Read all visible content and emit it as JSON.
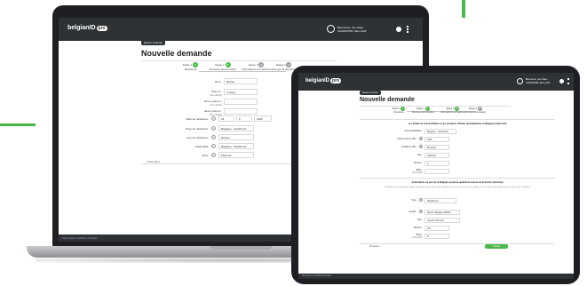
{
  "colors": {
    "accent": "#4ab84a",
    "header": "#2e3235",
    "device": "#1e1f22"
  },
  "laptop": {
    "app_logo": "belgianID",
    "logo_badge": "pro",
    "user_line1": "Bienvenue, Jan Claes",
    "user_line2": "0123456789 | Mon profil",
    "back_label": "Retour à l'écran",
    "page_title": "Nouvelle demande",
    "steps": [
      {
        "label": "Étape 1",
        "num": "1",
        "name": "Résidents",
        "status": "done"
      },
      {
        "label": "Étape 2",
        "num": "2",
        "name": "Données personnelles",
        "status": "done"
      },
      {
        "label": "Étape 3",
        "num": "3",
        "name": "Informations de l'adresse",
        "status": "todo"
      },
      {
        "label": "Étape 4",
        "num": "4",
        "name": "Envoyer la demande",
        "status": "todo"
      }
    ],
    "fields": [
      {
        "label": "Nom :",
        "value": "Buisse"
      },
      {
        "label": "Prénom :",
        "sub": "(Facultatif)",
        "value": "Ludwig"
      },
      {
        "label": "2ème prénom :",
        "sub": "(Facultatif)",
        "value": ""
      },
      {
        "label": "3ème prénom :",
        "sub": "(Facultatif)",
        "value": ""
      }
    ],
    "birth": {
      "label": "Date de naissance :",
      "day": "04",
      "month": "6",
      "year": "1992"
    },
    "fields2": [
      {
        "label": "Pays de naissance :",
        "value": "Belgique - Nederland"
      },
      {
        "label": "Lieu de naissance :",
        "value": "Namen"
      },
      {
        "label": "Nationalité :",
        "value": "Belgique - Nederland"
      },
      {
        "label": "Sexe :",
        "value": "Masculin"
      }
    ],
    "prev_label": "Précédent",
    "footer_links": "Vie privée   Conditions   Contact"
  },
  "tablet": {
    "app_logo": "belgianID",
    "logo_badge": "pro",
    "user_line1": "Bienvenue, Jan Claes",
    "user_line2": "0123456789 | Mon profil",
    "back_label": "Retour à l'écran",
    "page_title": "Nouvelle demande",
    "steps": [
      {
        "label": "Étape 1",
        "num": "1",
        "name": "Résidents",
        "status": "done"
      },
      {
        "label": "Étape 2",
        "num": "2",
        "name": "Données personnelles",
        "status": "done"
      },
      {
        "label": "Étape 3",
        "num": "3",
        "name": "Informations de l'adresse",
        "status": "done"
      },
      {
        "label": "Étape 4",
        "num": "4",
        "name": "Envoyer la demande",
        "status": "todo"
      }
    ],
    "section1_title": "Les détails de la domiciliation et les résidents officiels (actuellement) en Belgique (optionnel)",
    "addr_fields": [
      {
        "label": "Pays d'habitation :",
        "value": "Belgique - Nederland"
      },
      {
        "label": "Code postal et Ville :",
        "value": "1000"
      },
      {
        "label": "Localité et Ville :",
        "value": "Bruxelles"
      },
      {
        "label": "Rue :",
        "value": "Aalstraat"
      },
      {
        "label": "Numéro :",
        "value": "5"
      },
      {
        "label": "Boîte :",
        "sub": "(Facultatif)",
        "value": ""
      }
    ],
    "section2_title": "Antécédents au sein de la Belgique jusqu'au quatrième annexe du domicile (optionnel)",
    "section2_desc": "Conformément aux dispositions légales, les données déjà traitées depuis l'application sont transmises au service public, pour être utilisées par l'administration et l'adresse de la Belgique.",
    "type_field": {
      "label": "Type :",
      "value": "Résidences"
    },
    "addr2_fields": [
      {
        "label": "Localité :",
        "value": "Namur, Belgique (5000)"
      },
      {
        "label": "Rue :",
        "value": "Avenue Hessens"
      },
      {
        "label": "Numéro :",
        "value": "102"
      },
      {
        "label": "Boîte :",
        "sub": "(Facultatif)",
        "value": "B"
      }
    ],
    "prev_label": "Précédent",
    "next_label": "Suivant",
    "footer_links": "Vie privée   Conditions   Contact"
  }
}
